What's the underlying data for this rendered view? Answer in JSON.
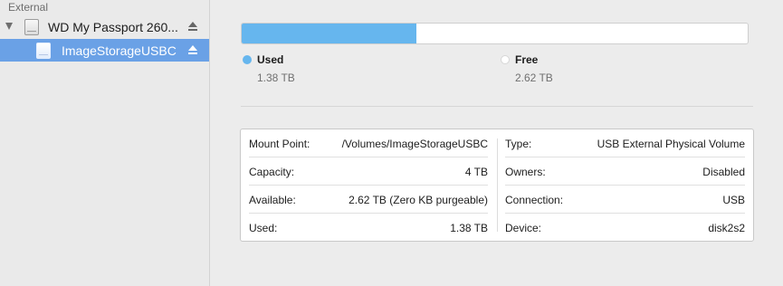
{
  "sidebar": {
    "section_header": "External",
    "disk": {
      "label": "WD My Passport 260...",
      "icon": "external-disk-icon"
    },
    "volume": {
      "label": "ImageStorageUSBC",
      "icon": "volume-icon",
      "selected": true
    }
  },
  "usage": {
    "used_fraction": 0.345,
    "used_color": "#66b6ee",
    "free_color": "#ffffff",
    "used": {
      "title": "Used",
      "value": "1.38 TB"
    },
    "free": {
      "title": "Free",
      "value": "2.62 TB"
    }
  },
  "info": {
    "left": [
      {
        "label": "Mount Point:",
        "value": "/Volumes/ImageStorageUSBC"
      },
      {
        "label": "Capacity:",
        "value": "4 TB"
      },
      {
        "label": "Available:",
        "value": "2.62 TB (Zero KB purgeable)"
      },
      {
        "label": "Used:",
        "value": "1.38 TB"
      }
    ],
    "right": [
      {
        "label": "Type:",
        "value": "USB External Physical Volume"
      },
      {
        "label": "Owners:",
        "value": "Disabled"
      },
      {
        "label": "Connection:",
        "value": "USB"
      },
      {
        "label": "Device:",
        "value": "disk2s2"
      }
    ]
  }
}
